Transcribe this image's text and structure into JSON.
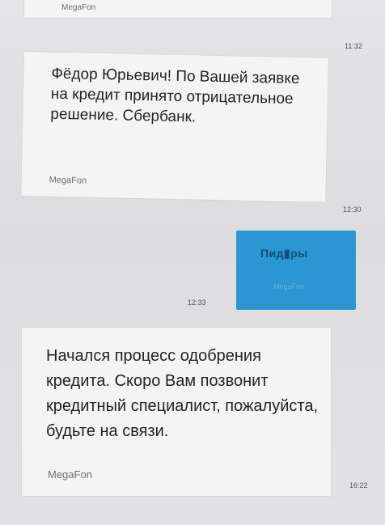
{
  "messages": [
    {
      "direction": "incoming",
      "text": "",
      "sender": "MegaFon",
      "time": ""
    },
    {
      "direction": "incoming",
      "text": "Фёдор Юрьевич! По Вашей заявке на кредит принято отрицательное решение. Сбербанк.",
      "sender": "MegaFon",
      "time": "11:32"
    },
    {
      "direction": "outgoing",
      "text": "Пид▮ры",
      "sender": "MegaFon",
      "time": "12:30"
    },
    {
      "direction": "incoming",
      "text": "Начался процесс одобрения кредита. Скоро Вам позвонит кредитный специалист, пожалуйста, будьте на связи.",
      "sender": "MegaFon",
      "time": "12:33"
    },
    {
      "direction": "incoming",
      "text": "",
      "sender": "",
      "time": "16:22"
    }
  ],
  "colors": {
    "background": "#dcdcde",
    "incoming_bubble": "#f4f4f4",
    "outgoing_bubble": "#2a97d2"
  }
}
